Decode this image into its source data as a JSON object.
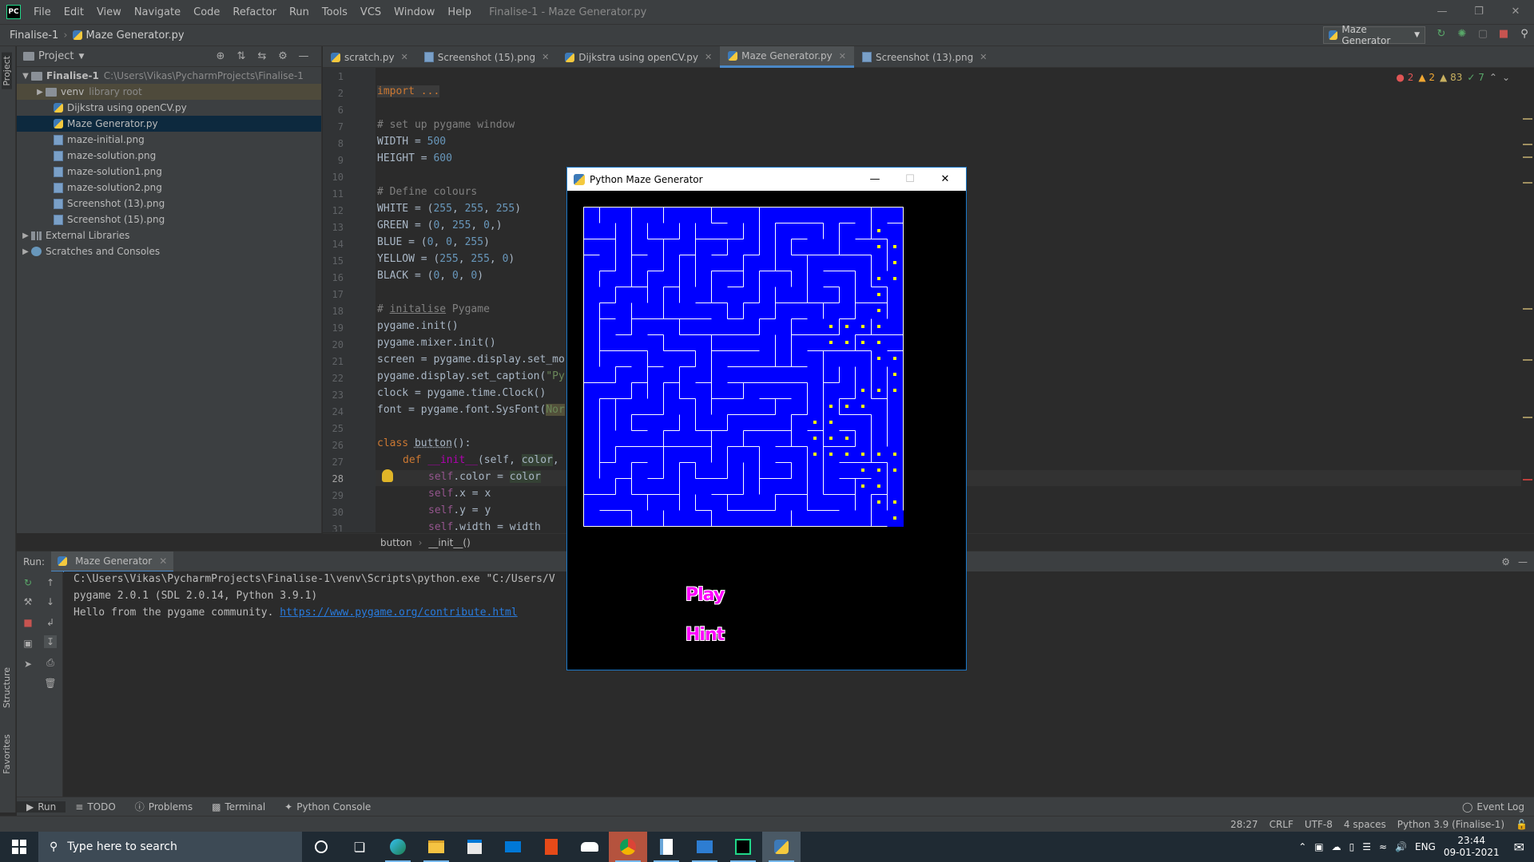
{
  "menubar": {
    "app_logo": "PC",
    "items": [
      "File",
      "Edit",
      "View",
      "Navigate",
      "Code",
      "Refactor",
      "Run",
      "Tools",
      "VCS",
      "Window",
      "Help"
    ],
    "window_title": "Finalise-1 - Maze Generator.py"
  },
  "navbar": {
    "project": "Finalise-1",
    "file": "Maze Generator.py",
    "run_config": "Maze Generator"
  },
  "sidebar_labels": {
    "project": "Project",
    "structure": "Structure",
    "favorites": "Favorites"
  },
  "project_panel": {
    "title": "Project",
    "root": {
      "name": "Finalise-1",
      "path": "C:\\Users\\Vikas\\PycharmProjects\\Finalise-1"
    },
    "venv": {
      "name": "venv",
      "hint": "library root"
    },
    "files": [
      "Dijkstra using openCV.py",
      "Maze Generator.py",
      "maze-initial.png",
      "maze-solution.png",
      "maze-solution1.png",
      "maze-solution2.png",
      "Screenshot (13).png",
      "Screenshot (15).png"
    ],
    "external": "External Libraries",
    "scratches": "Scratches and Consoles"
  },
  "tabs": [
    "scratch.py",
    "Screenshot (15).png",
    "Dijkstra using openCV.py",
    "Maze Generator.py",
    "Screenshot (13).png"
  ],
  "inspections": {
    "errors": "2",
    "warnings": "2",
    "weak": "83",
    "ok": "7"
  },
  "code": {
    "line_numbers": [
      "1",
      "2",
      "6",
      "7",
      "8",
      "9",
      "10",
      "11",
      "12",
      "13",
      "14",
      "15",
      "16",
      "17",
      "18",
      "19",
      "20",
      "21",
      "22",
      "23",
      "24",
      "25",
      "26",
      "27",
      "28",
      "29",
      "30",
      "31"
    ],
    "l2": "import ...",
    "l7": "# set up pygame window",
    "l8a": "WIDTH = ",
    "l8b": "500",
    "l9a": "HEIGHT = ",
    "l9b": "600",
    "l11": "# Define colours",
    "l12a": "WHITE = (",
    "l12b": "255",
    "l12c": ", ",
    "l12d": "255",
    "l12e": ", ",
    "l12f": "255",
    "l12g": ")",
    "l13a": "GREEN = (",
    "l13b": "0",
    "l13c": ", ",
    "l13d": "255",
    "l13e": ", ",
    "l13f": "0",
    "l13g": ",)",
    "l14a": "BLUE = (",
    "l14b": "0",
    "l14c": ", ",
    "l14d": "0",
    "l14e": ", ",
    "l14f": "255",
    "l14g": ")",
    "l15a": "YELLOW = (",
    "l15b": "255",
    "l15c": ", ",
    "l15d": "255",
    "l15e": ", ",
    "l15f": "0",
    "l15g": ")",
    "l16a": "BLACK = (",
    "l16b": "0",
    "l16c": ", ",
    "l16d": "0",
    "l16e": ", ",
    "l16f": "0",
    "l16g": ")",
    "l18a": "# ",
    "l18b": "initalise",
    " l18c": " Pygame",
    "l19": "pygame.init()",
    "l20": "pygame.mixer.init()",
    "l21": "screen = pygame.display.set_mo",
    "l22a": "pygame.display.set_caption(",
    "l22b": "\"Py",
    "l23": "clock = pygame.time.Clock()",
    "l24a": "font = pygame.font.SysFont(",
    "l24b": "Nor",
    "l26a": "class ",
    "l26b": "button",
    "l26c": "():",
    "l27a": "def ",
    "l27b": "__init__",
    "l27c": "(self, ",
    "l27d": "color",
    ", l27e": ",",
    "l28a": "self",
    ".l28b": ".color = color",
    "l29a": "self",
    "l29b": ".x = x",
    "l30a": "self",
    "l30b": ".y = y",
    "l31a": "self",
    "l31b": ".width = width"
  },
  "breadcrumb": {
    "class": "button",
    "method": "__init__()"
  },
  "run_panel": {
    "label": "Run:",
    "tab": "Maze Generator",
    "lines": [
      "C:\\Users\\Vikas\\PycharmProjects\\Finalise-1\\venv\\Scripts\\python.exe \"C:/Users/V",
      "pygame 2.0.1 (SDL 2.0.14, Python 3.9.1)"
    ],
    "hello": "Hello from the pygame community. ",
    "url": "https://www.pygame.org/contribute.html"
  },
  "bottom_tabs": [
    "Run",
    "TODO",
    "Problems",
    "Terminal",
    "Python Console"
  ],
  "event_log": "Event Log",
  "status": {
    "pos": "28:27",
    "eol": "CRLF",
    "enc": "UTF-8",
    "indent": "4 spaces",
    "interp": "Python 3.9 (Finalise-1)"
  },
  "pygame_window": {
    "title": "Python Maze Generator",
    "play": "Play",
    "hint": "Hint"
  },
  "taskbar": {
    "search": "Type here to search",
    "lang": "ENG",
    "time": "23:44",
    "date": "09-01-2021"
  },
  "colors": {
    "maze_bg": "#0000ff",
    "maze_walls": "#ffffff",
    "solution_dots": "#ffff00",
    "button_text": "#ff00ff",
    "accent": "#4a88c7"
  }
}
